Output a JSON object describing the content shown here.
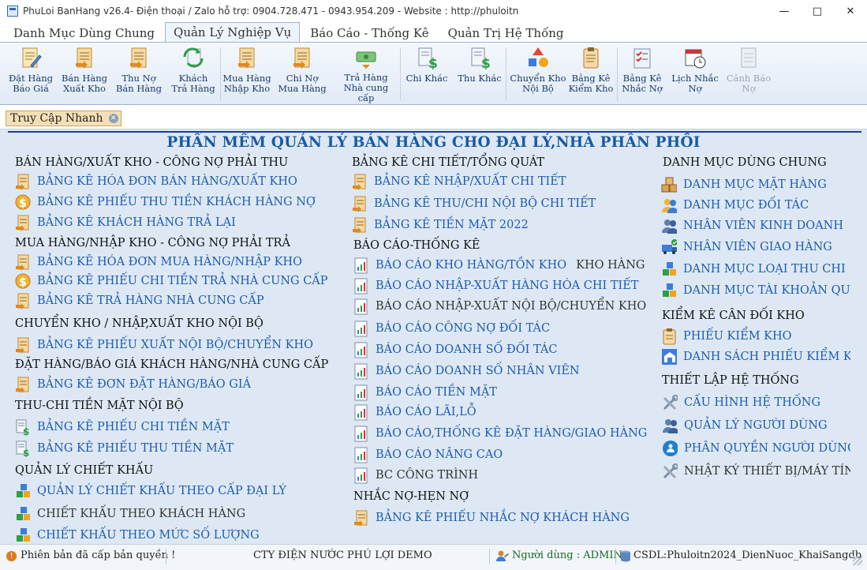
{
  "window": {
    "title": "PhuLoi BanHang v26.4- Điện thoại / Zalo hỗ trợ: 0904.728.471 - 0943.954.209 - Website : http://phuloitn",
    "minimize": "—",
    "maximize": "□",
    "close": "✕"
  },
  "tabs": [
    {
      "label": "Danh Mục Dùng Chung"
    },
    {
      "label": "Quản Lý Nghiệp Vụ"
    },
    {
      "label": "Báo Cáo - Thống Kê"
    },
    {
      "label": "Quản Trị Hệ Thống"
    }
  ],
  "ribbon": [
    {
      "line1": "Đặt Hàng",
      "line2": "Báo Giá",
      "icon": "document-pencil-icon"
    },
    {
      "line1": "Bán Hàng",
      "line2": "Xuất Kho",
      "icon": "document-arrow-icon"
    },
    {
      "line1": "Thu Nợ",
      "line2": "Bán Hàng",
      "icon": "document-arrow-icon"
    },
    {
      "line1": "Khách",
      "line2": "Trả Hàng",
      "icon": "return-arrows-icon"
    },
    {
      "line1": "Mua Hàng",
      "line2": "Nhập Kho",
      "icon": "document-arrow-icon"
    },
    {
      "line1": "Chi Nợ",
      "line2": "Mua Hàng",
      "icon": "document-arrow-icon"
    },
    {
      "line1": "Trả Hàng",
      "line2": "Nhà cung cấp",
      "icon": "money-return-icon"
    },
    {
      "line1": "Chi Khác",
      "line2": "",
      "icon": "dollar-document-icon"
    },
    {
      "line1": "Thu Khác",
      "line2": "",
      "icon": "dollar-document-icon"
    },
    {
      "line1": "Chuyển Kho",
      "line2": "Nội Bộ",
      "icon": "shapes-transfer-icon"
    },
    {
      "line1": "Bảng Kê",
      "line2": "Kiểm Kho",
      "icon": "clipboard-icon"
    },
    {
      "line1": "Bảng Kê",
      "line2": "Nhắc Nợ",
      "icon": "checklist-icon"
    },
    {
      "line1": "Lịch Nhắc",
      "line2": "Nợ",
      "icon": "calendar-clock-icon"
    },
    {
      "line1": "Cảnh Báo",
      "line2": "Nợ",
      "icon": "warning-document-icon"
    }
  ],
  "quick_tab": {
    "label": "Truy Cập Nhanh",
    "close": "✕"
  },
  "heading": "PHẦN MỀM QUẢN LÝ BÁN HÀNG CHO ĐẠI LÝ,NHÀ PHÂN PHỐI",
  "col1": {
    "s1": "BÁN HÀNG/XUẤT KHO - CÔNG NỢ PHẢI THU",
    "l1": "BẢNG KÊ HÓA ĐƠN BÁN HÀNG/XUẤT KHO",
    "l2": "BẢNG KÊ PHIẾU THU TIỀN KHÁCH HÀNG NỢ",
    "l3": "BẢNG KÊ KHÁCH HÀNG TRẢ LẠI",
    "s2": "MUA HÀNG/NHẬP KHO - CÔNG NỢ PHẢI TRẢ",
    "l4": "BẢNG KÊ HÓA ĐƠN MUA HÀNG/NHẬP KHO",
    "l5": "BẢNG KÊ PHIẾU CHI TIỀN TRẢ NHÀ CUNG CẤP",
    "l6": "BẢNG KÊ TRẢ HÀNG NHÀ CUNG CẤP",
    "s3": "CHUYỂN KHO / NHẬP,XUẤT KHO NỘI BỘ",
    "l7": "BẢNG KÊ PHIẾU XUẤT NỘI BỘ/CHUYỂN KHO",
    "s4": "ĐẶT HÀNG/BÁO GIÁ KHÁCH HÀNG/NHÀ CUNG CẤP",
    "l8": "BẢNG KÊ ĐƠN ĐẶT HÀNG/BÁO GIÁ",
    "s5": "THU-CHI TIỀN MẶT NỘI BỘ",
    "l9": "BẢNG KÊ PHIẾU CHI TIỀN MẶT",
    "l10": "BẢNG KÊ PHIẾU THU TIỀN MẶT",
    "s6": "QUẢN LÝ CHIẾT KHẤU",
    "l11": "QUẢN LÝ CHIẾT KHẤU THEO CẤP ĐẠI LÝ",
    "l12": "CHIẾT KHẤU THEO KHÁCH HÀNG",
    "l13": "CHIẾT KHẤU THEO MỨC SỐ LƯỢNG"
  },
  "col2": {
    "s1": "BẢNG KÊ CHI TIẾT/TỔNG QUÁT",
    "l1": "BẢNG KÊ NHẬP/XUẤT CHI TIẾT",
    "l2": "BẢNG KÊ THU/CHI NỘI BỘ CHI TIẾT",
    "l3": "BẢNG KÊ TIỀN MẶT 2022",
    "s2": "BÁO CÁO-THỐNG KÊ",
    "l4": "BÁO CÁO KHO HÀNG/TỒN KHO",
    "l4b": "KHO HÀNG",
    "l5": "BÁO CÁO NHẬP-XUẤT HÀNG HÓA CHI TIẾT",
    "l6": "BÁO CÁO NHẬP-XUẤT NỘI BỘ/CHUYỂN KHO",
    "l7": "BÁO CÁO CÔNG NỢ ĐỐI TÁC",
    "l8": "BÁO CÁO DOANH SỐ ĐỐI TÁC",
    "l9": "BÁO CÁO DOANH SỐ NHÂN VIÊN",
    "l10": "BÁO CÁO TIỀN MẶT",
    "l11": "BÁO CÁO LÃI,LỖ",
    "l12": "BÁO CÁO,THỐNG KÊ ĐẶT HÀNG/GIAO HÀNG",
    "l13": "BÁO CÁO NÂNG CAO",
    "l14": "BC CÔNG TRÌNH",
    "s3": "NHẮC NỢ-HẸN NỢ",
    "l15": "BẢNG KÊ PHIẾU NHẮC NỢ KHÁCH HÀNG"
  },
  "col3": {
    "s1": "DANH MỤC DÙNG CHUNG",
    "l1": "DANH MỤC MẶT HÀNG",
    "l2": "DANH MỤC ĐỐI TÁC",
    "l3": "NHÂN VIÊN KINH DOANH",
    "l4": "NHÂN VIÊN GIAO HÀNG",
    "l5": "DANH MỤC LOẠI THU CHI",
    "l6": "DANH MỤC TÀI KHOẢN QUỸ",
    "s2": "KIỂM KÊ CÂN ĐỐI KHO",
    "l7": "PHIẾU KIỂM KHO",
    "l8": "DANH SÁCH PHIẾU KIỂM KHO",
    "s3": "THIẾT LẬP HỆ THỐNG",
    "l9": "CẤU HÌNH HỆ THỐNG",
    "l10": "QUẢN LÝ NGƯỜI DÙNG",
    "l11": "PHÂN QUYỀN NGƯỜI DÙNG",
    "l12": "NHẬT KÝ THIẾT BỊ/MÁY TÍNH"
  },
  "status": {
    "license": "Phiên bản đã cấp bản quyền !",
    "company": "CTY ĐIỆN NƯỚC PHÚ LỢI DEMO",
    "user": "Người dùng : ADMIN",
    "db": "CSDL:Phuloitn2024_DienNuoc_KhaiSangdb"
  },
  "colors": {
    "link": "#1e5bb0",
    "heading": "#1a5aa3",
    "content_bg": "#dde8f4",
    "chip": "#f5dfb6"
  }
}
